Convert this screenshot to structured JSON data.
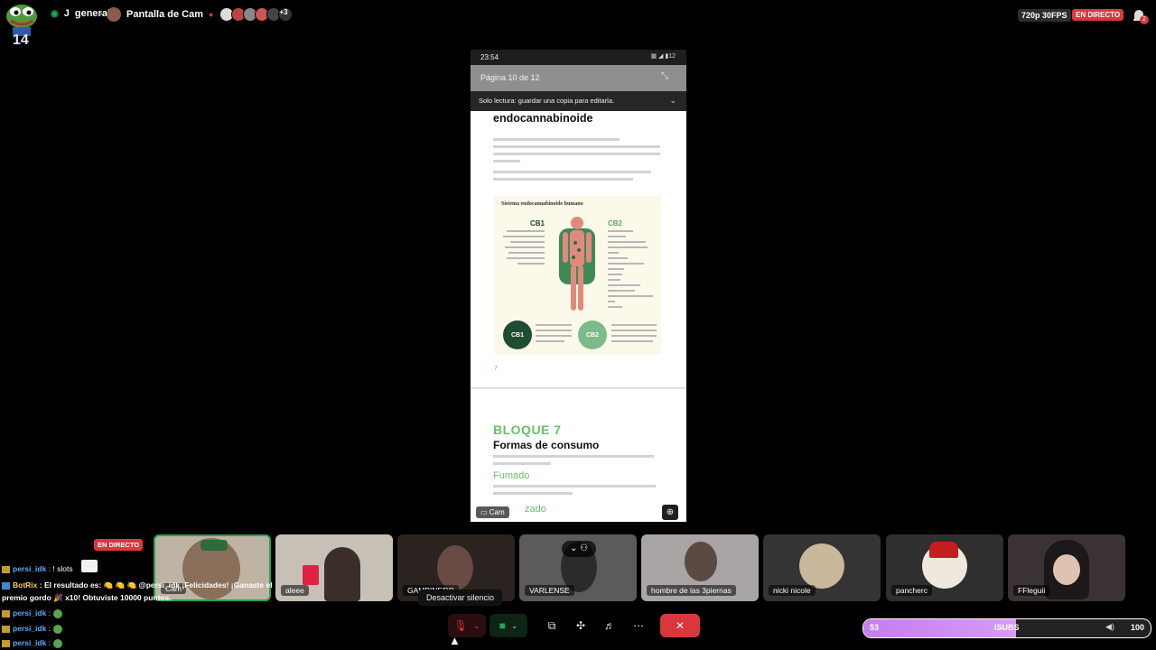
{
  "top": {
    "channel_name": "general",
    "channel_prefix": "J",
    "share_title": "Pantalla de Cam",
    "participants_more": "+3",
    "quality": "720p 30FPS",
    "live": "EN DIRECTO",
    "notification_count": "2",
    "overlay_count": "14"
  },
  "phone": {
    "time": "23:54",
    "battery": "12",
    "page_indicator": "Página 10 de 12",
    "readonly_banner": "Solo lectura: guardar una copia para editarla.",
    "doc_heading": "endocannabinoide",
    "infographic_title": "Sistema endocannabinoide humano",
    "cb1_label": "CB1",
    "cb2_label": "CB2",
    "cb1_circle": "CB1",
    "cb2_circle": "CB2",
    "page_number": "7",
    "bloque": "BLOQUE 7",
    "section_title": "Formas de consumo",
    "subsection": "Fumado",
    "subsection2": "zado",
    "cam_tag": "Cam"
  },
  "tiles": [
    {
      "label": "Cam"
    },
    {
      "label": "aleee"
    },
    {
      "label": "GAMBINERO"
    },
    {
      "label": "VARLENSE"
    },
    {
      "label": "hombre de las 3piernas"
    },
    {
      "label": "nicki nicole"
    },
    {
      "label": "pancherc"
    },
    {
      "label": "FFleguii"
    }
  ],
  "chat": {
    "live_badge": "EN DIRECTO",
    "lines": [
      {
        "user": "persi_idk",
        "text": " : ! slots"
      },
      {
        "user": "BotRix",
        "text": " : El resultado es: 🍋 🍋 🍋 @persi_idk ¡Felicidades! ¡Ganaste el"
      },
      {
        "user": "",
        "text": "premio gordo 🎉 x10! Obtuviste 10000 puntos."
      },
      {
        "user": "persi_idk",
        "text": " :"
      },
      {
        "user": "persi_idk",
        "text": " :"
      },
      {
        "user": "persi_idk",
        "text": " :"
      }
    ]
  },
  "controls": {
    "tooltip": "Desactivar silencio"
  },
  "subgoal": {
    "left": "53",
    "middle": "ISUBS",
    "right": "100",
    "progress": 0.53
  },
  "colors": {
    "live_red": "#da373c",
    "speaking_green": "#23a559",
    "doc_green": "#6abf6a",
    "goal_purple": "#c57df0"
  }
}
